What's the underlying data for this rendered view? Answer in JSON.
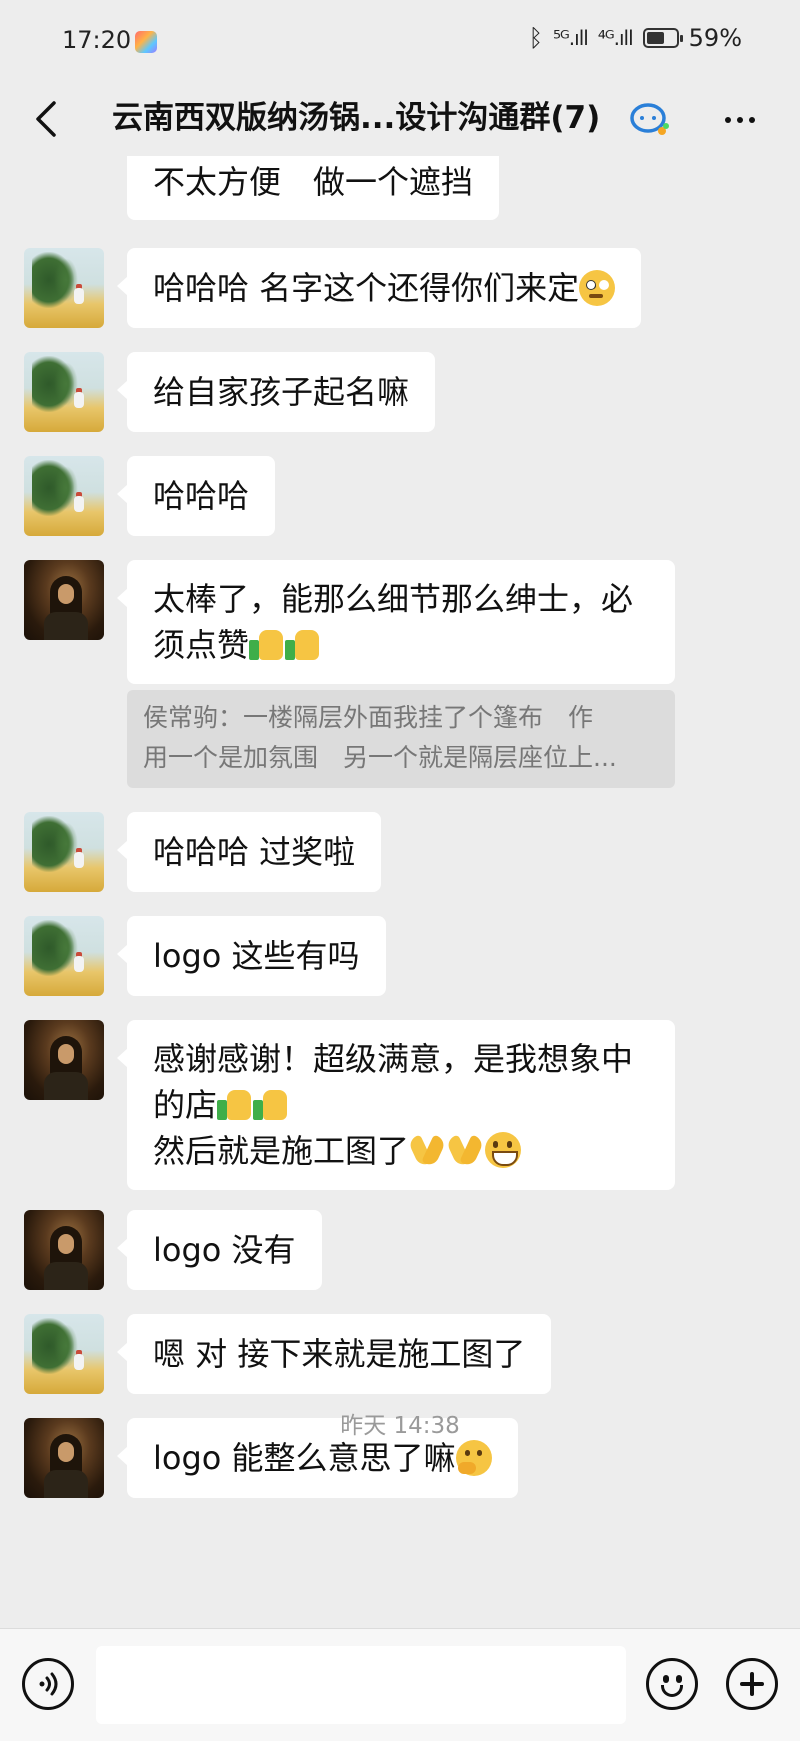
{
  "status_bar": {
    "time": "17:20",
    "signal_5g": "⁵ᴳ.ıll",
    "signal_4g": "⁴ᴳ.ıll",
    "battery_percent": "59%",
    "battery_level": 0.59
  },
  "header": {
    "title": "云南西双版纳汤锅...设计沟通群(7)"
  },
  "messages": [
    {
      "sender": "a",
      "text": "不太方便　做一个遮挡"
    },
    {
      "sender": "a",
      "text": "哈哈哈  名字这个还得你们来定"
    },
    {
      "sender": "a",
      "text": "给自家孩子起名嘛"
    },
    {
      "sender": "a",
      "text": "哈哈哈"
    },
    {
      "sender": "b",
      "line1": "太棒了，能那么细节那么绅士，必",
      "line2": "须点赞"
    },
    {
      "sender": "a",
      "text": "哈哈哈  过奖啦"
    },
    {
      "sender": "a",
      "text": "logo 这些有吗"
    },
    {
      "sender": "b",
      "line1": "感谢感谢！超级满意，是我想象中",
      "line2": "的店",
      "line3": "然后就是施工图了"
    },
    {
      "sender": "b",
      "text": "logo 没有"
    },
    {
      "sender": "a",
      "text": "嗯 对  接下来就是施工图了"
    },
    {
      "sender": "b",
      "text": "logo 能整么意思了嘛"
    }
  ],
  "quote": {
    "line1": "侯常驹：一楼隔层外面我挂了个篷布　作",
    "line2": "用一个是加氛围　另一个就是隔层座位上..."
  },
  "timestamp": "昨天 14:38",
  "input": {
    "value": ""
  },
  "icons": {
    "back": "chevron-left-icon",
    "chat": "chat-bubble-icon",
    "more": "more-dots-icon",
    "voice": "voice-icon",
    "emoji": "emoji-icon",
    "plus": "plus-icon"
  }
}
